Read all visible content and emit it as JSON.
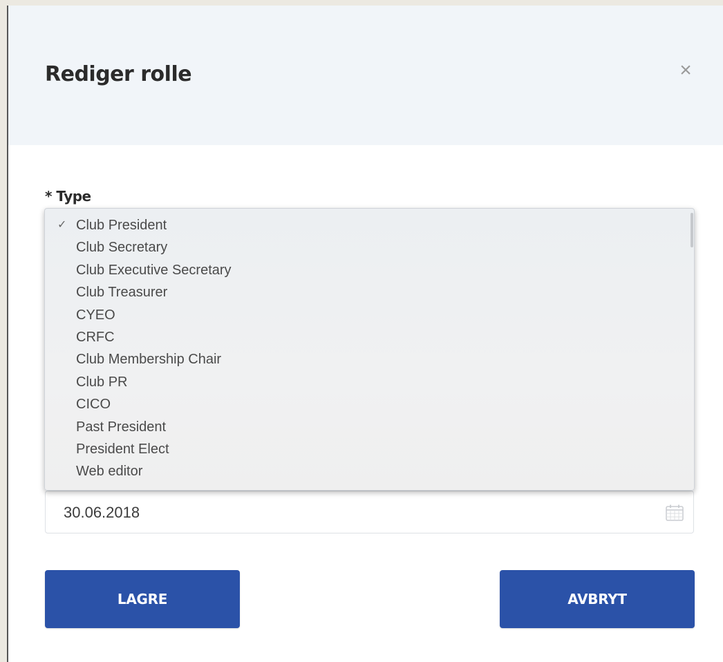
{
  "dialog": {
    "title": "Rediger rolle",
    "close_label": "×"
  },
  "type_field": {
    "label": "* Type",
    "selected": "Club President",
    "options": [
      {
        "label": "Club President",
        "checked": true
      },
      {
        "label": "Club Secretary",
        "checked": false
      },
      {
        "label": "Club Executive Secretary",
        "checked": false
      },
      {
        "label": "Club Treasurer",
        "checked": false
      },
      {
        "label": "CYEO",
        "checked": false
      },
      {
        "label": "CRFC",
        "checked": false
      },
      {
        "label": "Club Membership Chair",
        "checked": false
      },
      {
        "label": "Club PR",
        "checked": false
      },
      {
        "label": "CICO",
        "checked": false
      },
      {
        "label": "Past President",
        "checked": false
      },
      {
        "label": "President Elect",
        "checked": false
      },
      {
        "label": "Web editor",
        "checked": false
      }
    ],
    "check_icon": "checkmark-icon"
  },
  "date_field": {
    "value": "30.06.2018",
    "icon": "calendar-icon"
  },
  "actions": {
    "save_label": "LAGRE",
    "cancel_label": "AVBRYT"
  },
  "colors": {
    "primary": "#2b52a8",
    "header_bg": "#f1f5f9"
  }
}
